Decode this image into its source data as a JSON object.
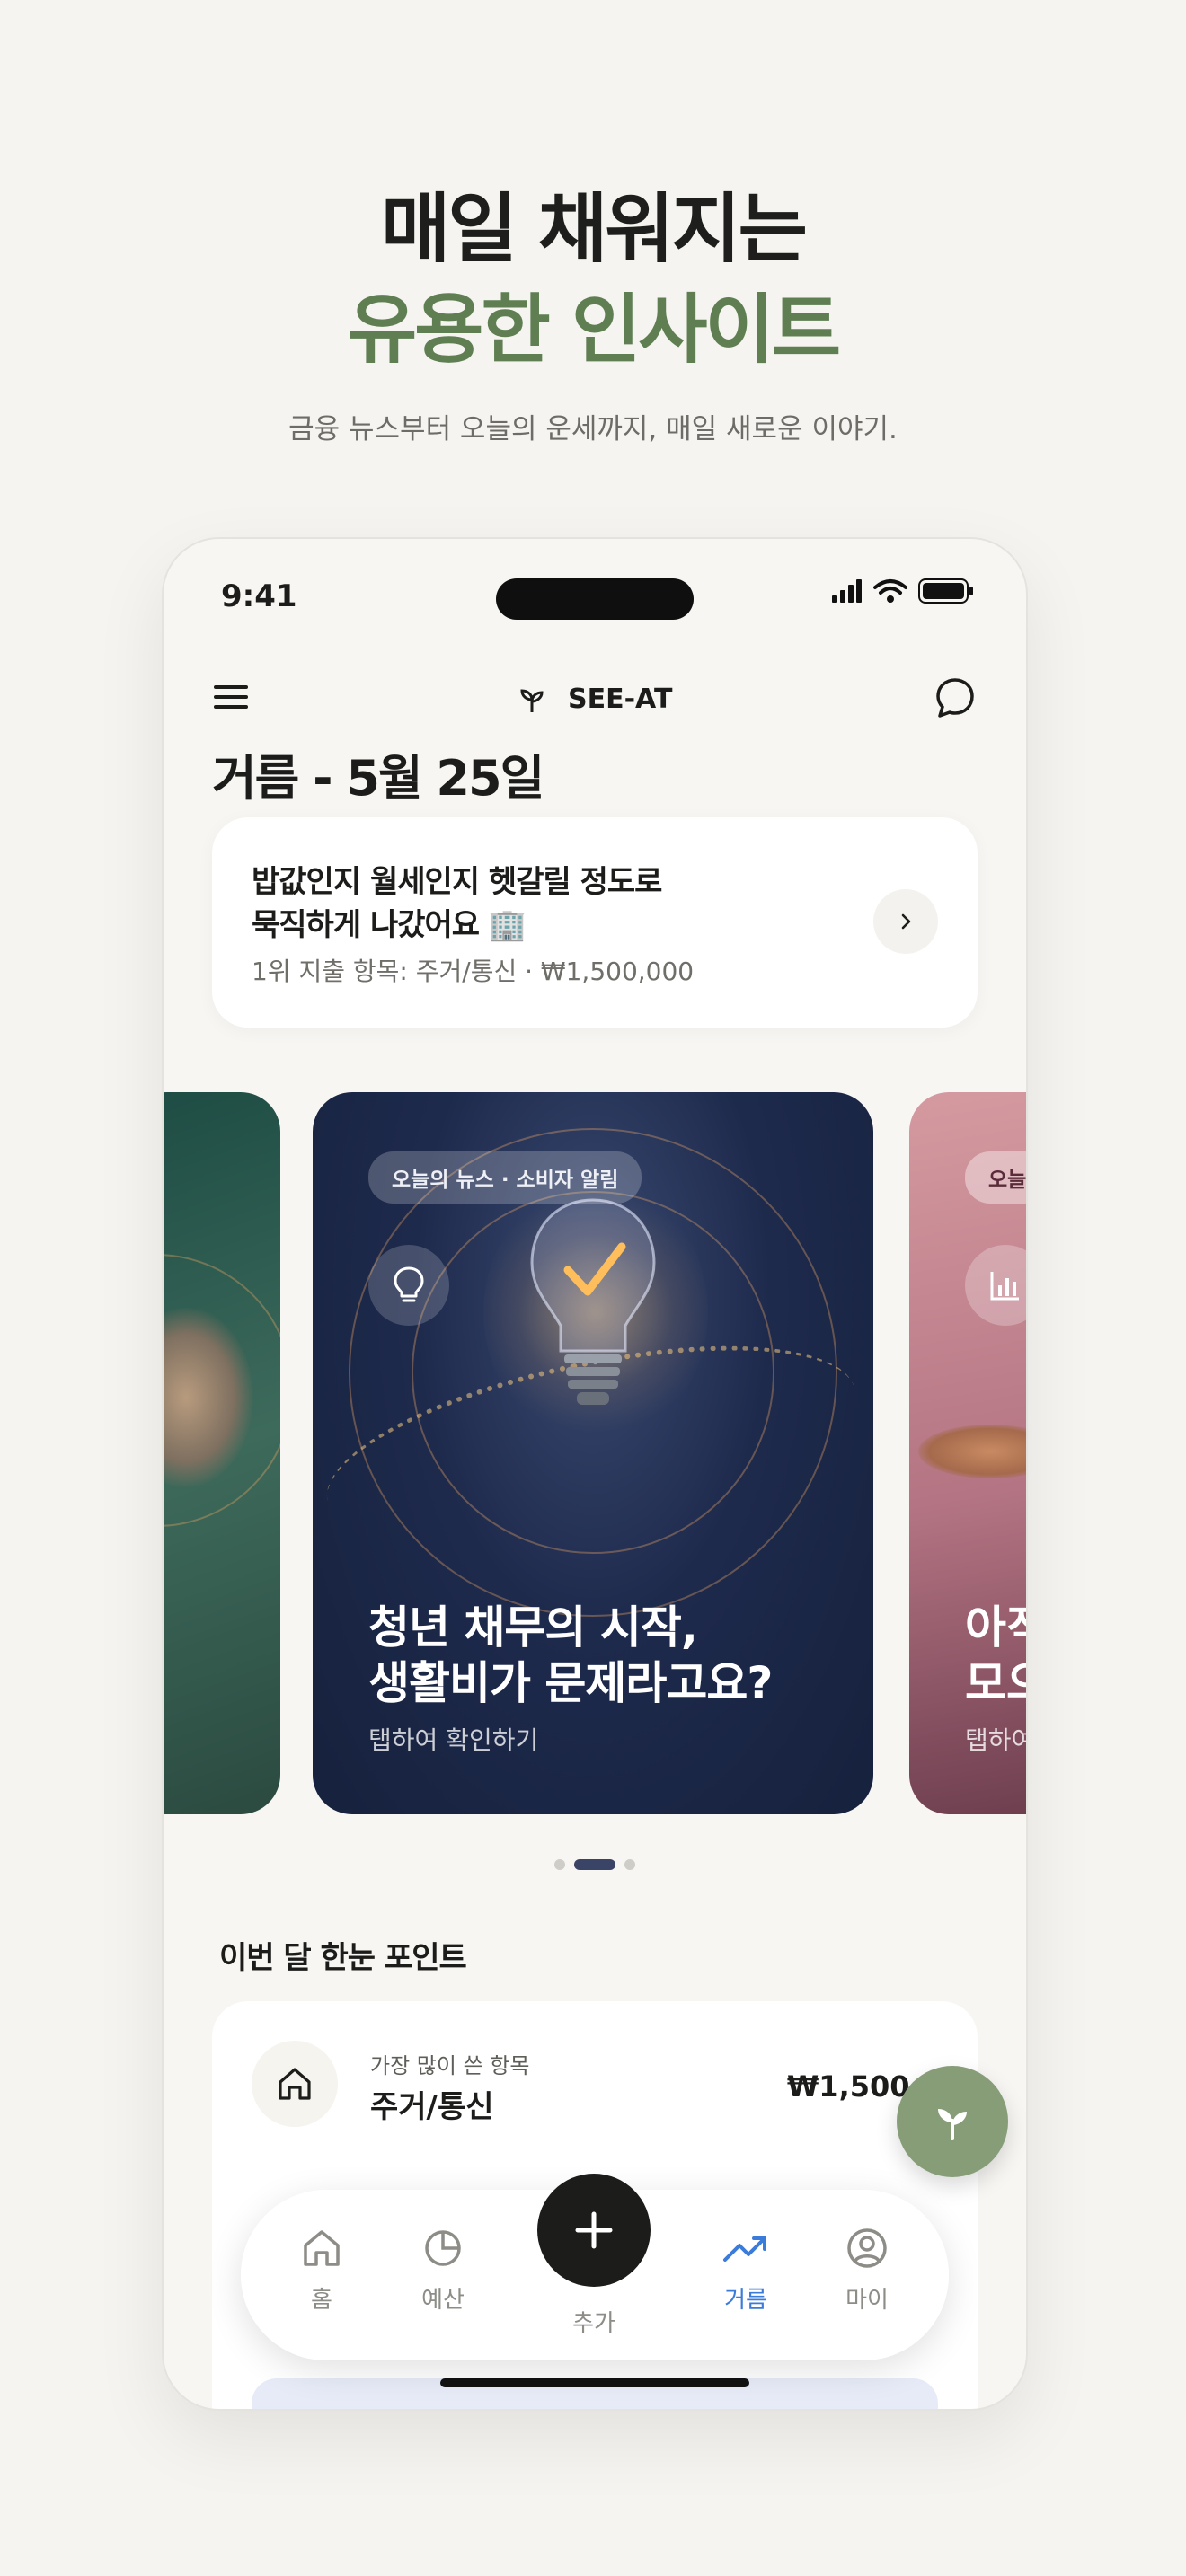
{
  "hero": {
    "line1": "매일 채워지는",
    "line2": "유용한 인사이트",
    "subtitle": "금융 뉴스부터 오늘의 운세까지, 매일 새로운 이야기.",
    "accent_color": "#5f7f52"
  },
  "status_bar": {
    "time": "9:41"
  },
  "app_bar": {
    "brand": "SEE-AT",
    "left_icon": "menu-icon",
    "right_icon": "chat-icon"
  },
  "page_title": "거름 - 5월 25일",
  "summary": {
    "line1": "밥값인지 월세인지 헷갈릴 정도로",
    "line2": "묵직하게 나갔어요 🏢",
    "meta": "1위 지출 항목: 주거/통신 · ₩1,500,000"
  },
  "carousel": {
    "main_card": {
      "tag": "오늘의 뉴스 · 소비자 알림",
      "icon": "lightbulb-icon",
      "title_line1": "청년 채무의 시작,",
      "title_line2": "생활비가 문제라고요?",
      "cta": "탭하여 확인하기"
    },
    "next_card": {
      "tag": "오늘",
      "icon": "bar-chart-icon",
      "title_line1": "아직",
      "title_line2": "모으",
      "cta": "탭하여"
    },
    "active_index": 1,
    "count": 3
  },
  "points": {
    "section_title": "이번 달 한눈 포인트",
    "top_item_label": "가장 많이 쓴 항목",
    "top_item_value": "주거/통신",
    "top_item_amount": "₩1,500,000"
  },
  "bottom_nav": {
    "items": [
      {
        "label": "홈",
        "icon": "home-icon"
      },
      {
        "label": "예산",
        "icon": "pie-chart-icon"
      },
      {
        "label": "추가",
        "icon": "plus-icon"
      },
      {
        "label": "거름",
        "icon": "trending-up-icon"
      },
      {
        "label": "마이",
        "icon": "user-icon"
      }
    ],
    "active_label": "거름",
    "active_color": "#3b7bd9"
  }
}
